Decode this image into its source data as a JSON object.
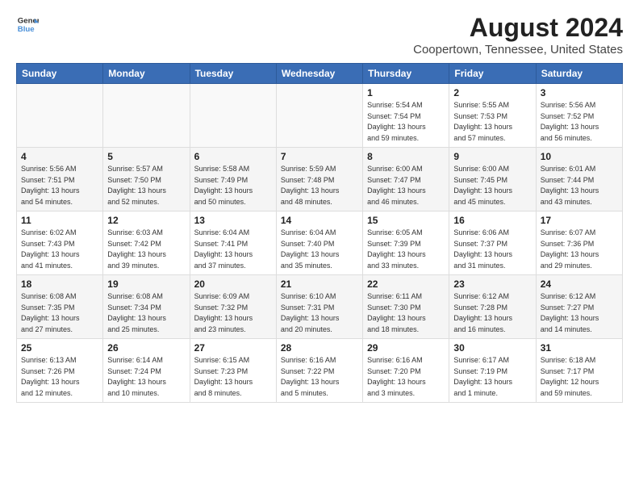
{
  "header": {
    "logo_line1": "General",
    "logo_line2": "Blue",
    "title": "August 2024",
    "subtitle": "Coopertown, Tennessee, United States"
  },
  "calendar": {
    "weekdays": [
      "Sunday",
      "Monday",
      "Tuesday",
      "Wednesday",
      "Thursday",
      "Friday",
      "Saturday"
    ],
    "weeks": [
      [
        {
          "day": "",
          "info": ""
        },
        {
          "day": "",
          "info": ""
        },
        {
          "day": "",
          "info": ""
        },
        {
          "day": "",
          "info": ""
        },
        {
          "day": "1",
          "info": "Sunrise: 5:54 AM\nSunset: 7:54 PM\nDaylight: 13 hours\nand 59 minutes."
        },
        {
          "day": "2",
          "info": "Sunrise: 5:55 AM\nSunset: 7:53 PM\nDaylight: 13 hours\nand 57 minutes."
        },
        {
          "day": "3",
          "info": "Sunrise: 5:56 AM\nSunset: 7:52 PM\nDaylight: 13 hours\nand 56 minutes."
        }
      ],
      [
        {
          "day": "4",
          "info": "Sunrise: 5:56 AM\nSunset: 7:51 PM\nDaylight: 13 hours\nand 54 minutes."
        },
        {
          "day": "5",
          "info": "Sunrise: 5:57 AM\nSunset: 7:50 PM\nDaylight: 13 hours\nand 52 minutes."
        },
        {
          "day": "6",
          "info": "Sunrise: 5:58 AM\nSunset: 7:49 PM\nDaylight: 13 hours\nand 50 minutes."
        },
        {
          "day": "7",
          "info": "Sunrise: 5:59 AM\nSunset: 7:48 PM\nDaylight: 13 hours\nand 48 minutes."
        },
        {
          "day": "8",
          "info": "Sunrise: 6:00 AM\nSunset: 7:47 PM\nDaylight: 13 hours\nand 46 minutes."
        },
        {
          "day": "9",
          "info": "Sunrise: 6:00 AM\nSunset: 7:45 PM\nDaylight: 13 hours\nand 45 minutes."
        },
        {
          "day": "10",
          "info": "Sunrise: 6:01 AM\nSunset: 7:44 PM\nDaylight: 13 hours\nand 43 minutes."
        }
      ],
      [
        {
          "day": "11",
          "info": "Sunrise: 6:02 AM\nSunset: 7:43 PM\nDaylight: 13 hours\nand 41 minutes."
        },
        {
          "day": "12",
          "info": "Sunrise: 6:03 AM\nSunset: 7:42 PM\nDaylight: 13 hours\nand 39 minutes."
        },
        {
          "day": "13",
          "info": "Sunrise: 6:04 AM\nSunset: 7:41 PM\nDaylight: 13 hours\nand 37 minutes."
        },
        {
          "day": "14",
          "info": "Sunrise: 6:04 AM\nSunset: 7:40 PM\nDaylight: 13 hours\nand 35 minutes."
        },
        {
          "day": "15",
          "info": "Sunrise: 6:05 AM\nSunset: 7:39 PM\nDaylight: 13 hours\nand 33 minutes."
        },
        {
          "day": "16",
          "info": "Sunrise: 6:06 AM\nSunset: 7:37 PM\nDaylight: 13 hours\nand 31 minutes."
        },
        {
          "day": "17",
          "info": "Sunrise: 6:07 AM\nSunset: 7:36 PM\nDaylight: 13 hours\nand 29 minutes."
        }
      ],
      [
        {
          "day": "18",
          "info": "Sunrise: 6:08 AM\nSunset: 7:35 PM\nDaylight: 13 hours\nand 27 minutes."
        },
        {
          "day": "19",
          "info": "Sunrise: 6:08 AM\nSunset: 7:34 PM\nDaylight: 13 hours\nand 25 minutes."
        },
        {
          "day": "20",
          "info": "Sunrise: 6:09 AM\nSunset: 7:32 PM\nDaylight: 13 hours\nand 23 minutes."
        },
        {
          "day": "21",
          "info": "Sunrise: 6:10 AM\nSunset: 7:31 PM\nDaylight: 13 hours\nand 20 minutes."
        },
        {
          "day": "22",
          "info": "Sunrise: 6:11 AM\nSunset: 7:30 PM\nDaylight: 13 hours\nand 18 minutes."
        },
        {
          "day": "23",
          "info": "Sunrise: 6:12 AM\nSunset: 7:28 PM\nDaylight: 13 hours\nand 16 minutes."
        },
        {
          "day": "24",
          "info": "Sunrise: 6:12 AM\nSunset: 7:27 PM\nDaylight: 13 hours\nand 14 minutes."
        }
      ],
      [
        {
          "day": "25",
          "info": "Sunrise: 6:13 AM\nSunset: 7:26 PM\nDaylight: 13 hours\nand 12 minutes."
        },
        {
          "day": "26",
          "info": "Sunrise: 6:14 AM\nSunset: 7:24 PM\nDaylight: 13 hours\nand 10 minutes."
        },
        {
          "day": "27",
          "info": "Sunrise: 6:15 AM\nSunset: 7:23 PM\nDaylight: 13 hours\nand 8 minutes."
        },
        {
          "day": "28",
          "info": "Sunrise: 6:16 AM\nSunset: 7:22 PM\nDaylight: 13 hours\nand 5 minutes."
        },
        {
          "day": "29",
          "info": "Sunrise: 6:16 AM\nSunset: 7:20 PM\nDaylight: 13 hours\nand 3 minutes."
        },
        {
          "day": "30",
          "info": "Sunrise: 6:17 AM\nSunset: 7:19 PM\nDaylight: 13 hours\nand 1 minute."
        },
        {
          "day": "31",
          "info": "Sunrise: 6:18 AM\nSunset: 7:17 PM\nDaylight: 12 hours\nand 59 minutes."
        }
      ]
    ]
  }
}
